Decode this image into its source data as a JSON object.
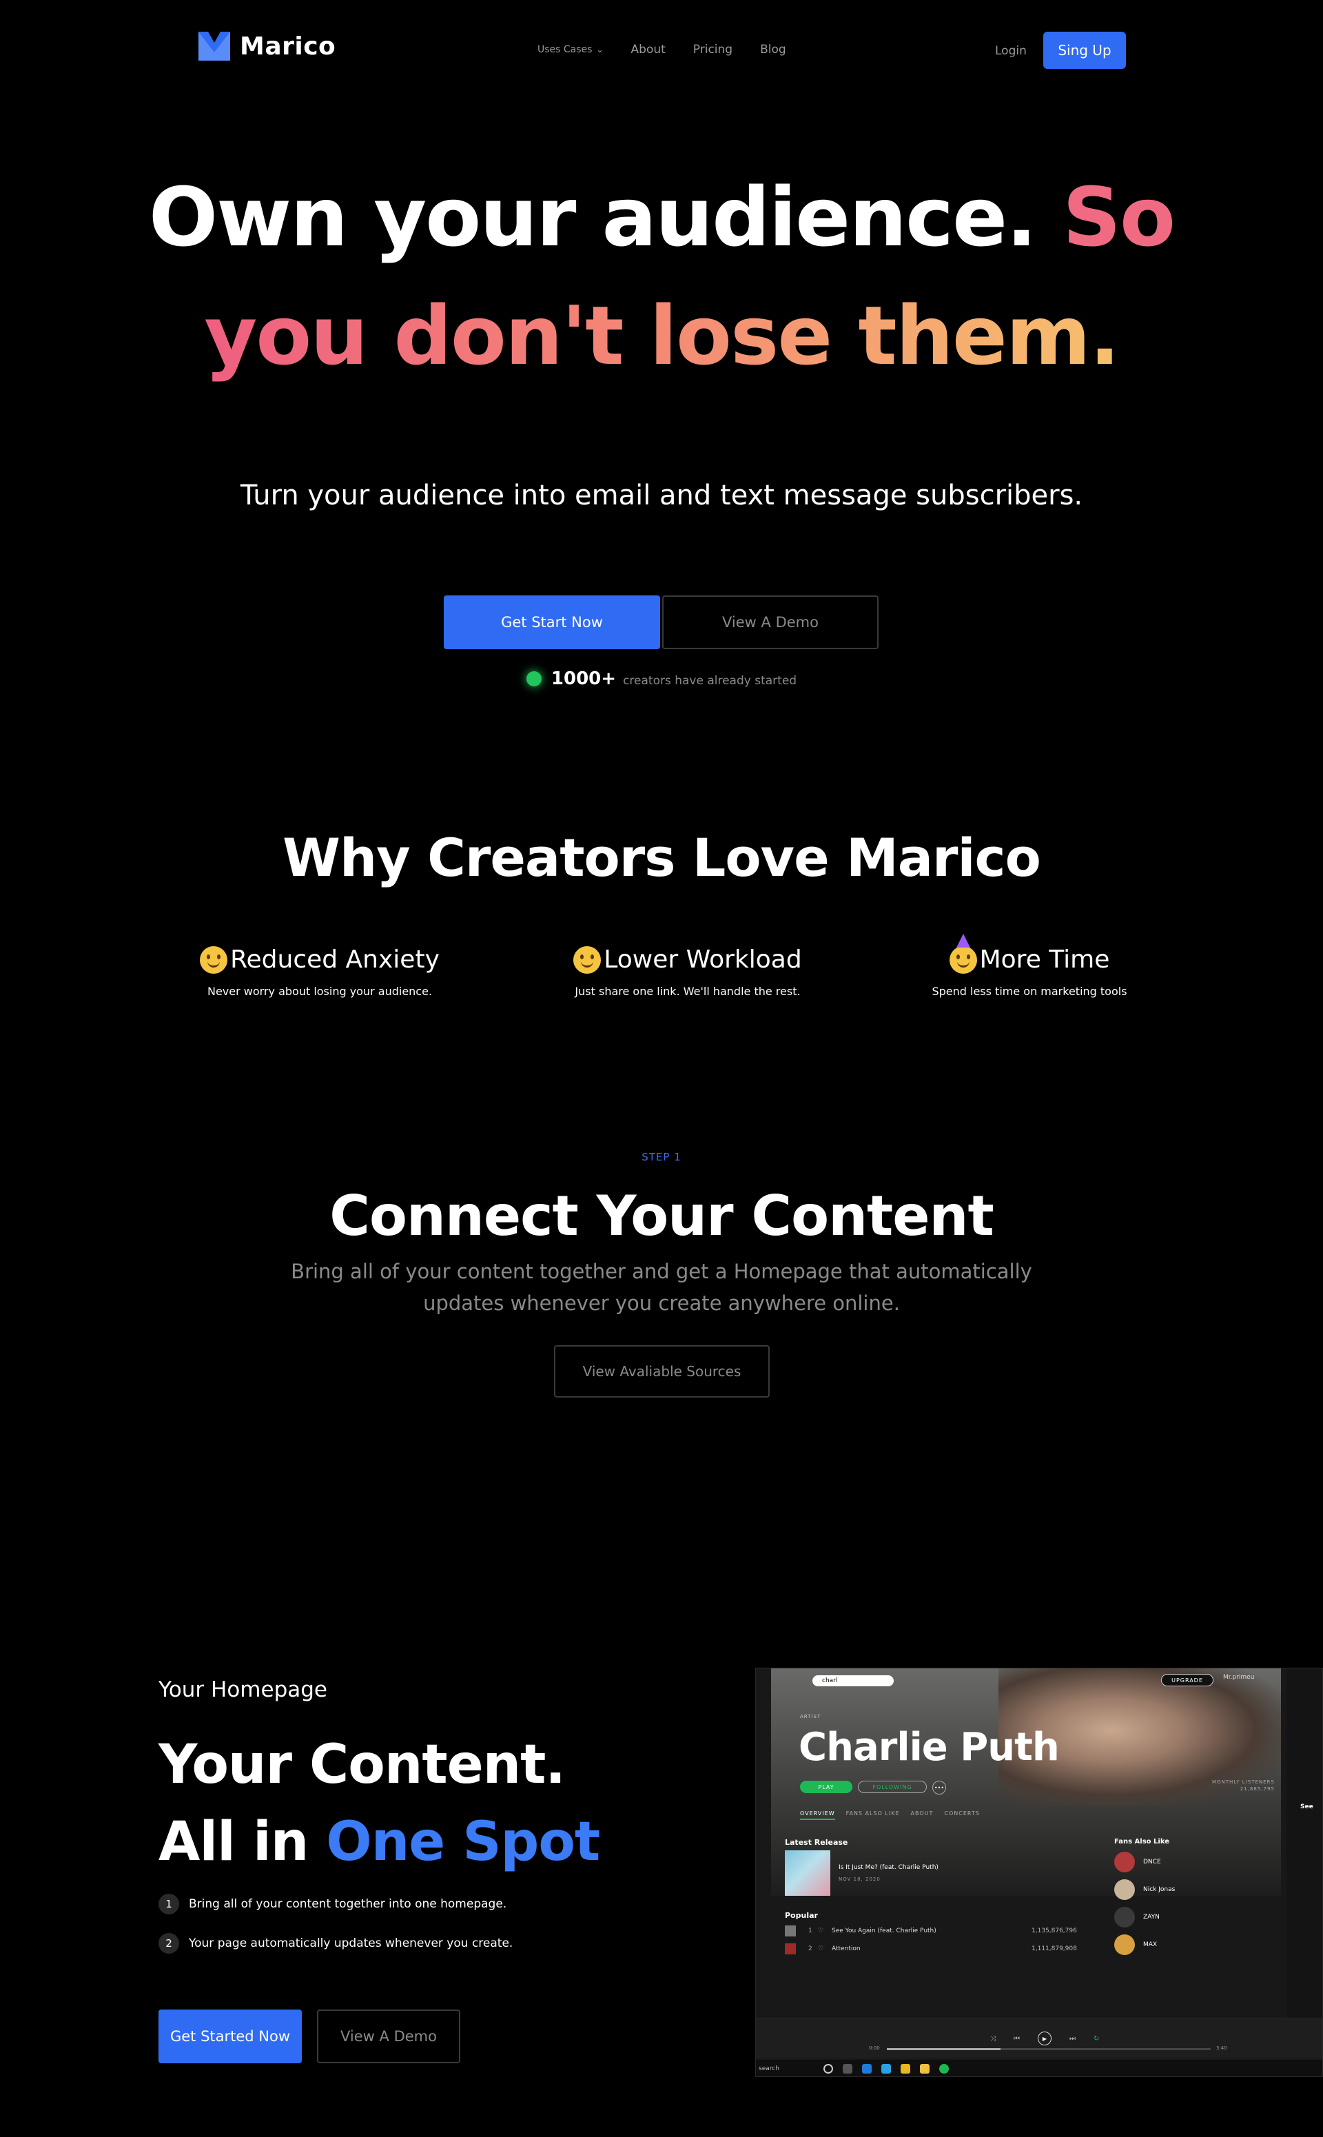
{
  "nav": {
    "brand": "Marico",
    "links": [
      "Uses Cases",
      "About",
      "Pricing",
      "Blog"
    ],
    "login": "Login",
    "signup": "Sing Up"
  },
  "hero": {
    "line1_white": "Own your audience.",
    "line1_accent": "So",
    "line2": "you don't lose them.",
    "subtitle": "Turn your audience into email and text message subscribers.",
    "cta_primary": "Get Start Now",
    "cta_secondary": "View A Demo",
    "creators_count": "1000+",
    "creators_text": "creators have already started"
  },
  "why": {
    "title": "Why Creators Love Marico",
    "features": [
      {
        "title": "Reduced Anxiety",
        "desc": "Never worry about losing your audience.",
        "icon": "smile-emoji-icon"
      },
      {
        "title": "Lower Workload",
        "desc": "Just share one link. We'll handle the rest.",
        "icon": "grin-emoji-icon"
      },
      {
        "title": "More Time",
        "desc": "Spend less time on marketing tools",
        "icon": "party-emoji-icon"
      }
    ]
  },
  "step": {
    "label": "STEP 1",
    "title": "Connect Your Content",
    "subtitle": "Bring all of your content together and get a Homepage that automatically updates whenever you create anywhere online.",
    "button": "View Avaliable Sources"
  },
  "homepage": {
    "label": "Your Homepage",
    "title1": "Your Content.",
    "title2_white": "All in",
    "title2_blue": "One Spot",
    "bullets": [
      {
        "num": "1",
        "text": "Bring all of your content together into one homepage."
      },
      {
        "num": "2",
        "text": "Your page automatically updates whenever you create."
      }
    ],
    "cta_primary": "Get Started Now",
    "cta_secondary": "View A Demo"
  },
  "spotify": {
    "search_value": "charl",
    "upgrade": "UPGRADE",
    "user": "Mr.primeu",
    "artist_label": "ARTIST",
    "artist_name": "Charlie Puth",
    "play": "PLAY",
    "following": "FOLLOWING",
    "more": "•••",
    "monthly_label": "MONTHLY LISTENERS",
    "monthly_value": "21,885,795",
    "tabs": [
      "OVERVIEW",
      "FANS ALSO LIKE",
      "ABOUT",
      "CONCERTS"
    ],
    "latest_release": "Latest Release",
    "release_title": "Is It Just Me? (feat. Charlie Puth)",
    "release_date": "NOV 18, 2020",
    "popular": "Popular",
    "tracks": [
      {
        "n": "1",
        "title": "See You Again (feat. Charlie Puth)",
        "plays": "1,135,876,796"
      },
      {
        "n": "2",
        "title": "Attention",
        "plays": "1,111,879,908"
      }
    ],
    "fans_title": "Fans Also Like",
    "fans": [
      {
        "name": "DNCE",
        "color": "#b23a3a"
      },
      {
        "name": "Nick Jonas",
        "color": "#c9b59a"
      },
      {
        "name": "ZAYN",
        "color": "#3a3a3a"
      },
      {
        "name": "MAX",
        "color": "#d8a040"
      }
    ],
    "see_all": "See",
    "time_start": "0:00",
    "time_end": "3:40",
    "taskbar_search": "search"
  },
  "colors": {
    "accent_blue": "#2f6bf3",
    "pink": "#f06a82",
    "green": "#22c55e"
  }
}
